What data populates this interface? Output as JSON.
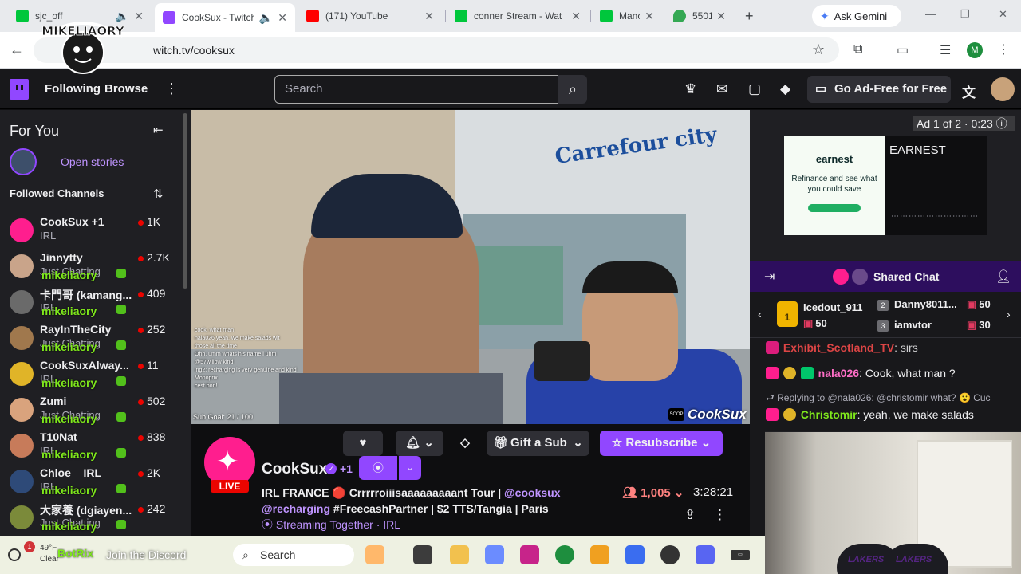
{
  "browser": {
    "tabs": [
      {
        "title": "sjc_off",
        "color": "#00c73c"
      },
      {
        "title": "CookSux - Twitch",
        "color": "#9147ff"
      },
      {
        "title": "(171) YouTube",
        "color": "#ff0000"
      },
      {
        "title": "conner Stream - Wat",
        "color": "#00c73c"
      },
      {
        "title": "Manc",
        "color": "#00c73c"
      },
      {
        "title": "5501",
        "color": "#34a853"
      }
    ],
    "gemini_label": "Ask Gemini",
    "url": "witch.tv/cooksux",
    "profile_initial": "M"
  },
  "watermark": {
    "text": "MIKELIAORY"
  },
  "twitch_nav": {
    "following": "Following",
    "browse": "Browse",
    "search_placeholder": "Search",
    "adfree": "Go Ad-Free for Free"
  },
  "sidebar": {
    "for_you": "For You",
    "open_stories": "Open stories",
    "followed_heading": "Followed Channels",
    "channels": [
      {
        "name": "CookSux +1",
        "category": "IRL",
        "viewers": "1K",
        "avatar_color": "#ff1e8e",
        "overlay": ""
      },
      {
        "name": "Jinnytty",
        "category": "Just Chatting",
        "viewers": "2.7K",
        "avatar_color": "#c9a48a",
        "overlay": "mikeliaory"
      },
      {
        "name": "卡門哥 (kamang...",
        "category": "IRL",
        "viewers": "409",
        "avatar_color": "#6a6a6a",
        "overlay": "mikeliaory"
      },
      {
        "name": "RayInTheCity",
        "category": "Just Chatting",
        "viewers": "252",
        "avatar_color": "#a0784d",
        "overlay": "mikeliaory"
      },
      {
        "name": "CookSuxAlway...",
        "category": "IRL",
        "viewers": "11",
        "avatar_color": "#e0b428",
        "overlay": "mikeliaory"
      },
      {
        "name": "Zumi",
        "category": "Just Chatting",
        "viewers": "502",
        "avatar_color": "#d9a37d",
        "overlay": "mikeliaory"
      },
      {
        "name": "T10Nat",
        "category": "IRL",
        "viewers": "838",
        "avatar_color": "#c77b5a",
        "overlay": "mikeliaory"
      },
      {
        "name": "Chloe__IRL",
        "category": "IRL",
        "viewers": "2K",
        "avatar_color": "#2e4a78",
        "overlay": "mikeliaory"
      },
      {
        "name": "大家養 (dgiayen...",
        "category": "Just Chatting",
        "viewers": "242",
        "avatar_color": "#7b8a3a",
        "overlay": "mikeliaory"
      }
    ]
  },
  "video": {
    "sign": "Carrefour city",
    "chat_overlay": [
      "cook, what man",
      "nala026 yeah, we make salads wit",
      "those all the time",
      "Ohh, umm whats his name i uhm",
      "@57willow kind",
      "ing2: recharging is very genuine and kind",
      "Monoprix",
      "cest bon!"
    ],
    "sub_goal": "Sub Goal: 21 / 100",
    "brand_tag": "CookSux"
  },
  "channel": {
    "name": "CookSux",
    "plus": "+1",
    "live": "LIVE",
    "gift_label": "Gift a Sub",
    "resub_label": "Resubscribe",
    "title_part1": "IRL FRANCE 🔴 Crrrrroiiisaaaaaaaaant Tour |",
    "title_mention1": "@cooksux",
    "title_mention2": "@recharging",
    "title_part2": "#FreecashPartner | $2 TTS/Tangia | Paris",
    "streaming_together": "Streaming Together · IRL",
    "viewers": "1,005",
    "uptime": "3:28:21"
  },
  "ad": {
    "counter": "Ad 1 of 2 · 0:23",
    "brand": "earnest",
    "copy": "Refinance and see what you could save",
    "title": "EARNEST"
  },
  "shared_chat": {
    "title": "Shared Chat"
  },
  "leaderboard": {
    "first": {
      "rank": "1",
      "name": "Icedout_911",
      "count": "50"
    },
    "second": {
      "rank": "2",
      "name": "Danny8011...",
      "count": "50"
    },
    "third": {
      "rank": "3",
      "name": "iamvtor",
      "count": "30"
    }
  },
  "chat": {
    "m0_user": "Exhibit_Scotland_TV",
    "m0_text": ": sirs",
    "m1_user": "nala026",
    "m1_text": ": Cook, what man ?",
    "reply_text": "Replying to @nala026: @christomir what? 😮 Cuc",
    "m2_user": "Christomir",
    "m2_text": ": yeah, we make salads"
  },
  "webcam": {
    "chair_text": "LAKERS"
  },
  "taskbar": {
    "alert_count": "1",
    "temp": "49°F",
    "condition": "Clear",
    "botrix": "BotRix",
    "discord_line": "Join the Discord",
    "search": "Search"
  }
}
